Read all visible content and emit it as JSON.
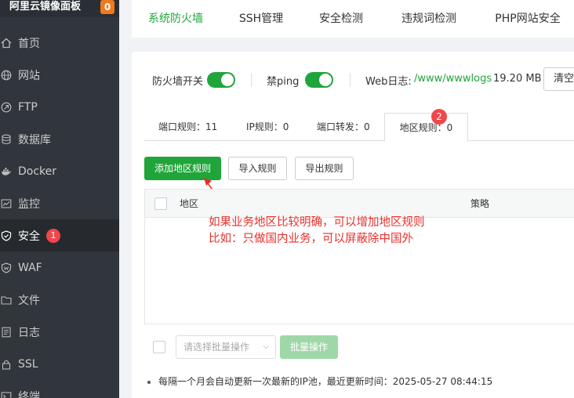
{
  "app": {
    "title": "阿里云镜像面板",
    "count": "0"
  },
  "sidebar": {
    "items": [
      {
        "label": "首页",
        "icon": "home-icon"
      },
      {
        "label": "网站",
        "icon": "globe-icon"
      },
      {
        "label": "FTP",
        "icon": "ftp-icon"
      },
      {
        "label": "数据库",
        "icon": "database-icon"
      },
      {
        "label": "Docker",
        "icon": "docker-icon"
      },
      {
        "label": "监控",
        "icon": "monitor-icon"
      },
      {
        "label": "安全",
        "icon": "shield-icon",
        "badge": "1",
        "active": true
      },
      {
        "label": "WAF",
        "icon": "waf-icon"
      },
      {
        "label": "文件",
        "icon": "folder-icon"
      },
      {
        "label": "日志",
        "icon": "log-icon"
      },
      {
        "label": "SSL",
        "icon": "ssl-icon"
      },
      {
        "label": "终端",
        "icon": "terminal-icon"
      }
    ]
  },
  "top_tabs": [
    "系统防火墙",
    "SSH管理",
    "安全检测",
    "违规词检测",
    "PHP网站安全"
  ],
  "switches": {
    "firewall_label": "防火墙开关",
    "ping_label": "禁ping",
    "weblog_label": "Web日志:",
    "weblog_path": "/www/wwwlogs",
    "weblog_size": "19.20 MB",
    "clear_button": "清空"
  },
  "sub_tabs": [
    "端口规则：11",
    "IP规则：0",
    "端口转发：0",
    "地区规则：0"
  ],
  "step2_badge": "2",
  "toolbar": {
    "add_button": "添加地区规则",
    "import_button": "导入规则",
    "export_button": "导出规则"
  },
  "table": {
    "columns": [
      "地区",
      "策略"
    ]
  },
  "annotation": {
    "line1": "如果业务地区比较明确，可以增加地区规则",
    "line2": "比如：只做国内业务，可以屏蔽除中国外"
  },
  "batch": {
    "select_placeholder": "请选择批量操作",
    "button": "批量操作"
  },
  "footer_note": "每隔一个月会自动更新一次最新的IP池，最近更新时间：2025-05-27 08:44:15",
  "colors": {
    "accent": "#20a53a",
    "sidebar_bg": "#31363c",
    "badge_red": "#f0474b",
    "annotation_red": "#e8302c",
    "count_orange": "#f0781e"
  }
}
